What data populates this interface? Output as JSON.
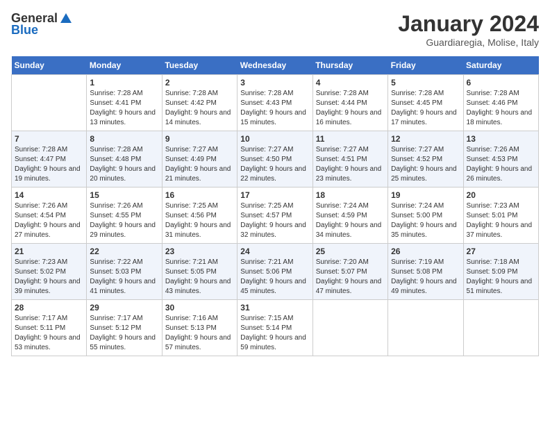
{
  "header": {
    "logo_general": "General",
    "logo_blue": "Blue",
    "title": "January 2024",
    "subtitle": "Guardiaregia, Molise, Italy"
  },
  "days_of_week": [
    "Sunday",
    "Monday",
    "Tuesday",
    "Wednesday",
    "Thursday",
    "Friday",
    "Saturday"
  ],
  "weeks": [
    [
      {
        "day": "",
        "sunrise": "",
        "sunset": "",
        "daylight": ""
      },
      {
        "day": "1",
        "sunrise": "Sunrise: 7:28 AM",
        "sunset": "Sunset: 4:41 PM",
        "daylight": "Daylight: 9 hours and 13 minutes."
      },
      {
        "day": "2",
        "sunrise": "Sunrise: 7:28 AM",
        "sunset": "Sunset: 4:42 PM",
        "daylight": "Daylight: 9 hours and 14 minutes."
      },
      {
        "day": "3",
        "sunrise": "Sunrise: 7:28 AM",
        "sunset": "Sunset: 4:43 PM",
        "daylight": "Daylight: 9 hours and 15 minutes."
      },
      {
        "day": "4",
        "sunrise": "Sunrise: 7:28 AM",
        "sunset": "Sunset: 4:44 PM",
        "daylight": "Daylight: 9 hours and 16 minutes."
      },
      {
        "day": "5",
        "sunrise": "Sunrise: 7:28 AM",
        "sunset": "Sunset: 4:45 PM",
        "daylight": "Daylight: 9 hours and 17 minutes."
      },
      {
        "day": "6",
        "sunrise": "Sunrise: 7:28 AM",
        "sunset": "Sunset: 4:46 PM",
        "daylight": "Daylight: 9 hours and 18 minutes."
      }
    ],
    [
      {
        "day": "7",
        "sunrise": "Sunrise: 7:28 AM",
        "sunset": "Sunset: 4:47 PM",
        "daylight": "Daylight: 9 hours and 19 minutes."
      },
      {
        "day": "8",
        "sunrise": "Sunrise: 7:28 AM",
        "sunset": "Sunset: 4:48 PM",
        "daylight": "Daylight: 9 hours and 20 minutes."
      },
      {
        "day": "9",
        "sunrise": "Sunrise: 7:27 AM",
        "sunset": "Sunset: 4:49 PM",
        "daylight": "Daylight: 9 hours and 21 minutes."
      },
      {
        "day": "10",
        "sunrise": "Sunrise: 7:27 AM",
        "sunset": "Sunset: 4:50 PM",
        "daylight": "Daylight: 9 hours and 22 minutes."
      },
      {
        "day": "11",
        "sunrise": "Sunrise: 7:27 AM",
        "sunset": "Sunset: 4:51 PM",
        "daylight": "Daylight: 9 hours and 23 minutes."
      },
      {
        "day": "12",
        "sunrise": "Sunrise: 7:27 AM",
        "sunset": "Sunset: 4:52 PM",
        "daylight": "Daylight: 9 hours and 25 minutes."
      },
      {
        "day": "13",
        "sunrise": "Sunrise: 7:26 AM",
        "sunset": "Sunset: 4:53 PM",
        "daylight": "Daylight: 9 hours and 26 minutes."
      }
    ],
    [
      {
        "day": "14",
        "sunrise": "Sunrise: 7:26 AM",
        "sunset": "Sunset: 4:54 PM",
        "daylight": "Daylight: 9 hours and 27 minutes."
      },
      {
        "day": "15",
        "sunrise": "Sunrise: 7:26 AM",
        "sunset": "Sunset: 4:55 PM",
        "daylight": "Daylight: 9 hours and 29 minutes."
      },
      {
        "day": "16",
        "sunrise": "Sunrise: 7:25 AM",
        "sunset": "Sunset: 4:56 PM",
        "daylight": "Daylight: 9 hours and 31 minutes."
      },
      {
        "day": "17",
        "sunrise": "Sunrise: 7:25 AM",
        "sunset": "Sunset: 4:57 PM",
        "daylight": "Daylight: 9 hours and 32 minutes."
      },
      {
        "day": "18",
        "sunrise": "Sunrise: 7:24 AM",
        "sunset": "Sunset: 4:59 PM",
        "daylight": "Daylight: 9 hours and 34 minutes."
      },
      {
        "day": "19",
        "sunrise": "Sunrise: 7:24 AM",
        "sunset": "Sunset: 5:00 PM",
        "daylight": "Daylight: 9 hours and 35 minutes."
      },
      {
        "day": "20",
        "sunrise": "Sunrise: 7:23 AM",
        "sunset": "Sunset: 5:01 PM",
        "daylight": "Daylight: 9 hours and 37 minutes."
      }
    ],
    [
      {
        "day": "21",
        "sunrise": "Sunrise: 7:23 AM",
        "sunset": "Sunset: 5:02 PM",
        "daylight": "Daylight: 9 hours and 39 minutes."
      },
      {
        "day": "22",
        "sunrise": "Sunrise: 7:22 AM",
        "sunset": "Sunset: 5:03 PM",
        "daylight": "Daylight: 9 hours and 41 minutes."
      },
      {
        "day": "23",
        "sunrise": "Sunrise: 7:21 AM",
        "sunset": "Sunset: 5:05 PM",
        "daylight": "Daylight: 9 hours and 43 minutes."
      },
      {
        "day": "24",
        "sunrise": "Sunrise: 7:21 AM",
        "sunset": "Sunset: 5:06 PM",
        "daylight": "Daylight: 9 hours and 45 minutes."
      },
      {
        "day": "25",
        "sunrise": "Sunrise: 7:20 AM",
        "sunset": "Sunset: 5:07 PM",
        "daylight": "Daylight: 9 hours and 47 minutes."
      },
      {
        "day": "26",
        "sunrise": "Sunrise: 7:19 AM",
        "sunset": "Sunset: 5:08 PM",
        "daylight": "Daylight: 9 hours and 49 minutes."
      },
      {
        "day": "27",
        "sunrise": "Sunrise: 7:18 AM",
        "sunset": "Sunset: 5:09 PM",
        "daylight": "Daylight: 9 hours and 51 minutes."
      }
    ],
    [
      {
        "day": "28",
        "sunrise": "Sunrise: 7:17 AM",
        "sunset": "Sunset: 5:11 PM",
        "daylight": "Daylight: 9 hours and 53 minutes."
      },
      {
        "day": "29",
        "sunrise": "Sunrise: 7:17 AM",
        "sunset": "Sunset: 5:12 PM",
        "daylight": "Daylight: 9 hours and 55 minutes."
      },
      {
        "day": "30",
        "sunrise": "Sunrise: 7:16 AM",
        "sunset": "Sunset: 5:13 PM",
        "daylight": "Daylight: 9 hours and 57 minutes."
      },
      {
        "day": "31",
        "sunrise": "Sunrise: 7:15 AM",
        "sunset": "Sunset: 5:14 PM",
        "daylight": "Daylight: 9 hours and 59 minutes."
      },
      {
        "day": "",
        "sunrise": "",
        "sunset": "",
        "daylight": ""
      },
      {
        "day": "",
        "sunrise": "",
        "sunset": "",
        "daylight": ""
      },
      {
        "day": "",
        "sunrise": "",
        "sunset": "",
        "daylight": ""
      }
    ]
  ]
}
